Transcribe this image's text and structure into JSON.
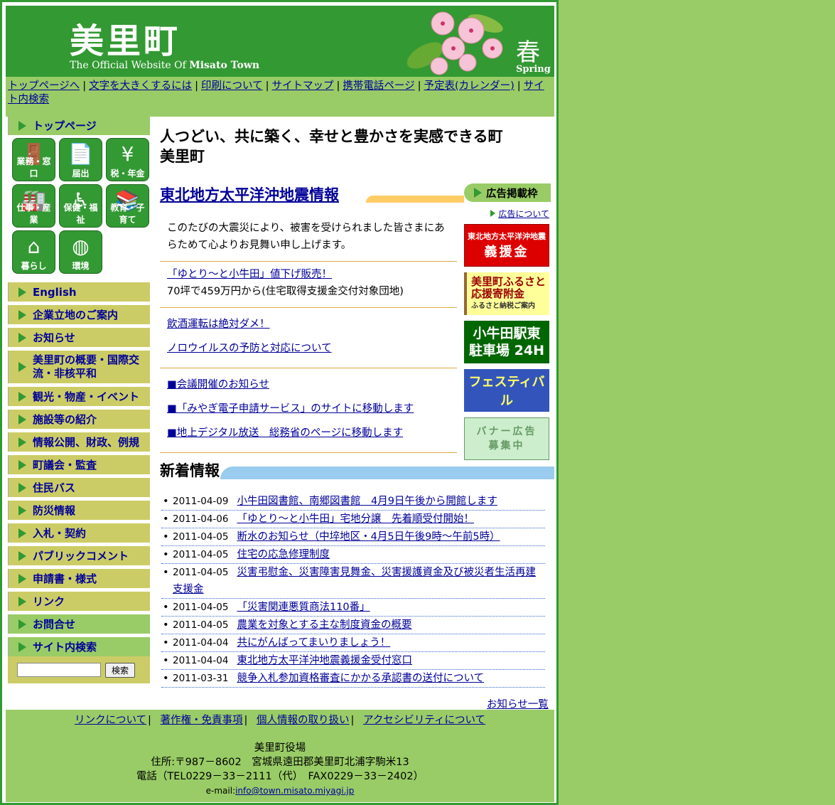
{
  "header": {
    "title": "美里町",
    "subtitle_prefix": "The Official Website Of ",
    "subtitle_bold": "Misato Town",
    "season_kanji": "春",
    "season_en": "Spring"
  },
  "topnav": {
    "items": [
      "トップページへ",
      "文字を大きくするには",
      "印刷について",
      "サイトマップ",
      "携帯電話ページ",
      "予定表(カレンダー)",
      "サイト内検索"
    ]
  },
  "sidebar": {
    "top": "トップページ",
    "icons": [
      "業務・窓口",
      "届出",
      "税・年金",
      "仕事・産業",
      "保健・福祉",
      "教育・子育て",
      "暮らし",
      "環境"
    ],
    "menu": [
      "English",
      "企業立地のご案内",
      "お知らせ",
      "美里町の概要・国際交流・非核平和",
      "観光・物産・イベント",
      "施設等の紹介",
      "情報公開、財政、例規",
      "町議会・監査",
      "住民バス",
      "防災情報",
      "入札・契約",
      "パブリックコメント",
      "申請書・様式",
      "リンク",
      "お問合せ"
    ],
    "search_label": "サイト内検索",
    "search_button": "検索",
    "search_value": ""
  },
  "main": {
    "slogan_line1": "人つどい、共に築く、幸せと豊かさを実感できる町",
    "slogan_line2": "美里町",
    "quake_title": "東北地方太平洋沖地震情報",
    "quake_msg": "このたびの大震災により、被害を受けられました皆さまにあらためて心よりお見舞い申し上げます。",
    "news_links": {
      "yutori": "「ゆとり〜と小牛田」値下げ販売！",
      "yutori_desc": "70坪で459万円から(住宅取得支援金交付対象団地)",
      "drink": "飲酒運転は絶対ダメ！",
      "noro": "ノロウイルスの予防と対応について",
      "meeting": "■会議開催のお知らせ",
      "miyagi": "■「みやぎ電子申請サービス」のサイトに移動します",
      "digital": "■地上デジタル放送　総務省のページに移動します"
    },
    "newinfo_title": "新着情報",
    "news": [
      {
        "date": "2011-04-09",
        "text": "小牛田図書館、南郷図書館　4月9日午後から開館します"
      },
      {
        "date": "2011-04-06",
        "text": "「ゆとり〜と小牛田」宅地分譲　先着順受付開始！"
      },
      {
        "date": "2011-04-05",
        "text": "断水のお知らせ（中埣地区・4月5日午後9時〜午前5時）"
      },
      {
        "date": "2011-04-05",
        "text": "住宅の応急修理制度"
      },
      {
        "date": "2011-04-05",
        "text": "災害弔慰金、災害障害見舞金、災害援護資金及び被災者生活再建支援金"
      },
      {
        "date": "2011-04-05",
        "text": "「災害関連悪質商法110番」"
      },
      {
        "date": "2011-04-05",
        "text": "農業を対象とする主な制度資金の概要"
      },
      {
        "date": "2011-04-04",
        "text": "共にがんばってまいりましょう！"
      },
      {
        "date": "2011-04-04",
        "text": "東北地方太平洋沖地震義援金受付窓口"
      },
      {
        "date": "2011-03-31",
        "text": "競争入札参加資格審査にかかる承認書の送付について"
      }
    ],
    "list_more": "お知らせ一覧"
  },
  "ads": {
    "head": "広告掲載枠",
    "about": "広告について",
    "ad1_line1": "東北地方太平洋沖地震",
    "ad1_line2": "義援金",
    "ad2_line1": "美里町ふるさと",
    "ad2_line2": "応援寄附金",
    "ad2_line3": "ふるさと納税ご案内",
    "ad3_line1": "小牛田駅東",
    "ad3_line2": "駐車場 24H",
    "ad4": "フェスティバル",
    "ad5_line1": "バナー広告",
    "ad5_line2": "募集中"
  },
  "footer": {
    "links": [
      "リンクについて",
      "著作権・免責事項",
      "個人情報の取り扱い",
      "アクセシビリティについて"
    ],
    "office": "美里町役場",
    "address": "住所:〒987－8602　宮城県遠田郡美里町北浦字駒米13",
    "tel": "電話（TEL0229－33－2111（代）　FAX0229－33－2402）",
    "mail_label": "e-mail:",
    "mail": "info@town.misato.miyagi.jp"
  }
}
